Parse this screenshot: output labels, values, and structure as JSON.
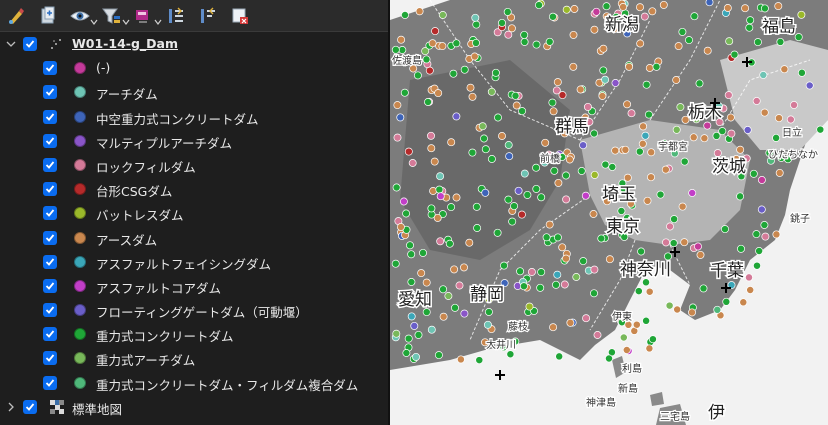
{
  "layers_panel": {
    "toolbar": [
      {
        "name": "open-layer-styling-icon"
      },
      {
        "name": "add-group-icon"
      },
      {
        "name": "manage-visibility-icon"
      },
      {
        "name": "filter-legend-icon"
      },
      {
        "name": "filter-by-expression-icon"
      },
      {
        "name": "expand-all-icon"
      },
      {
        "name": "collapse-all-icon"
      },
      {
        "name": "remove-layer-icon"
      }
    ],
    "layer": {
      "title": "W01-14-g_Dam",
      "categories": [
        {
          "label": "(-)",
          "color": "#c43a9a"
        },
        {
          "label": "アーチダム",
          "color": "#6ec4b4"
        },
        {
          "label": "中空重力式コンクリートダム",
          "color": "#3e64b8"
        },
        {
          "label": "マルティプルアーチダム",
          "color": "#8a55c8"
        },
        {
          "label": "ロックフィルダム",
          "color": "#d47a98"
        },
        {
          "label": "台形CSGダム",
          "color": "#b52a2a"
        },
        {
          "label": "バットレスダム",
          "color": "#9ab82a"
        },
        {
          "label": "アースダム",
          "color": "#c9874e"
        },
        {
          "label": "アスファルトフェイシングダム",
          "color": "#3aa6b8"
        },
        {
          "label": "アスファルトコアダム",
          "color": "#c23ec8"
        },
        {
          "label": "フローティングゲートダム（可動堰）",
          "color": "#6a5ec8"
        },
        {
          "label": "重力式コンクリートダム",
          "color": "#1fa637"
        },
        {
          "label": "重力式アーチダム",
          "color": "#78b85a"
        },
        {
          "label": "重力式コンクリートダム・フィルダム複合ダム",
          "color": "#4fb87a"
        }
      ]
    },
    "basemap": {
      "title": "標準地図"
    }
  },
  "map": {
    "labels": [
      {
        "text": "新潟",
        "big": true
      },
      {
        "text": "福島",
        "big": true
      },
      {
        "text": "群馬",
        "big": true
      },
      {
        "text": "栃木",
        "big": true
      },
      {
        "text": "茨城",
        "big": true
      },
      {
        "text": "埼玉",
        "big": true
      },
      {
        "text": "東京",
        "big": true
      },
      {
        "text": "神奈川",
        "big": true
      },
      {
        "text": "千葉",
        "big": true
      },
      {
        "text": "静岡",
        "big": true
      },
      {
        "text": "愛知",
        "big": true
      },
      {
        "text": "伊",
        "big": true
      },
      {
        "text": "佐渡島",
        "big": false
      },
      {
        "text": "日立",
        "big": false
      },
      {
        "text": "ひたちなか",
        "big": false
      },
      {
        "text": "銚子",
        "big": false
      },
      {
        "text": "藤枝",
        "big": false
      },
      {
        "text": "伊東",
        "big": false
      },
      {
        "text": "大井川",
        "big": false
      },
      {
        "text": "利島",
        "big": false
      },
      {
        "text": "新島",
        "big": false
      },
      {
        "text": "神津島",
        "big": false
      },
      {
        "text": "三宅島",
        "big": false
      },
      {
        "text": "前橋",
        "big": false
      },
      {
        "text": "宇都宮",
        "big": false
      }
    ]
  },
  "colors": {
    "checkbox": "#0a6cf0",
    "panel_bg": "#1e1e1e",
    "text": "#e8e8e8"
  }
}
